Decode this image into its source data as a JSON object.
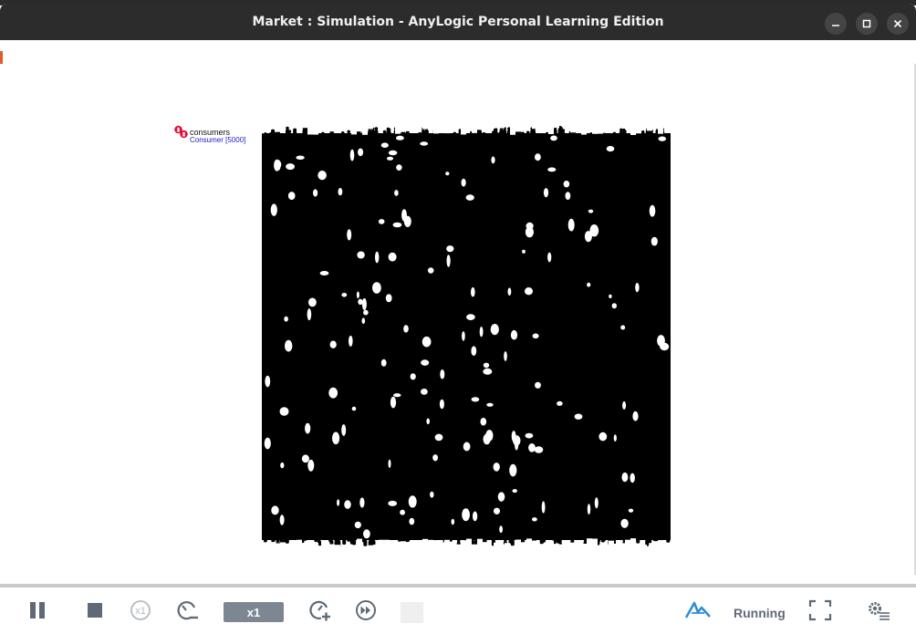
{
  "window": {
    "title": "Market : Simulation - AnyLogic Personal Learning Edition",
    "controls": [
      "minimize-icon",
      "maximize-icon",
      "close-icon"
    ]
  },
  "model": {
    "population_name": "consumers",
    "population_type": "Consumer [5000]",
    "agent_count": 5000,
    "agent_icon": "agent-population-icon",
    "accent_color": "#e0103a"
  },
  "toolbar": {
    "buttons": [
      {
        "name": "pause",
        "icon": "pause-icon"
      },
      {
        "name": "stop",
        "icon": "stop-icon"
      },
      {
        "name": "run-x1",
        "icon": "x1-circle-icon",
        "label": "x1"
      },
      {
        "name": "slow-down",
        "icon": "slow-down-icon"
      },
      {
        "name": "speed-up",
        "icon": "speed-up-icon"
      },
      {
        "name": "fast-forward",
        "icon": "fast-forward-icon"
      },
      {
        "name": "fullscreen",
        "icon": "fullscreen-icon"
      },
      {
        "name": "settings",
        "icon": "settings-icon"
      }
    ],
    "speed_label": "x1",
    "status": "Running",
    "logo_icon": "anylogic-logo-icon",
    "colors": {
      "icon_gray": "#5f6a76",
      "speed_bg": "#7d8792",
      "logo_blue": "#2f8fd6"
    }
  }
}
